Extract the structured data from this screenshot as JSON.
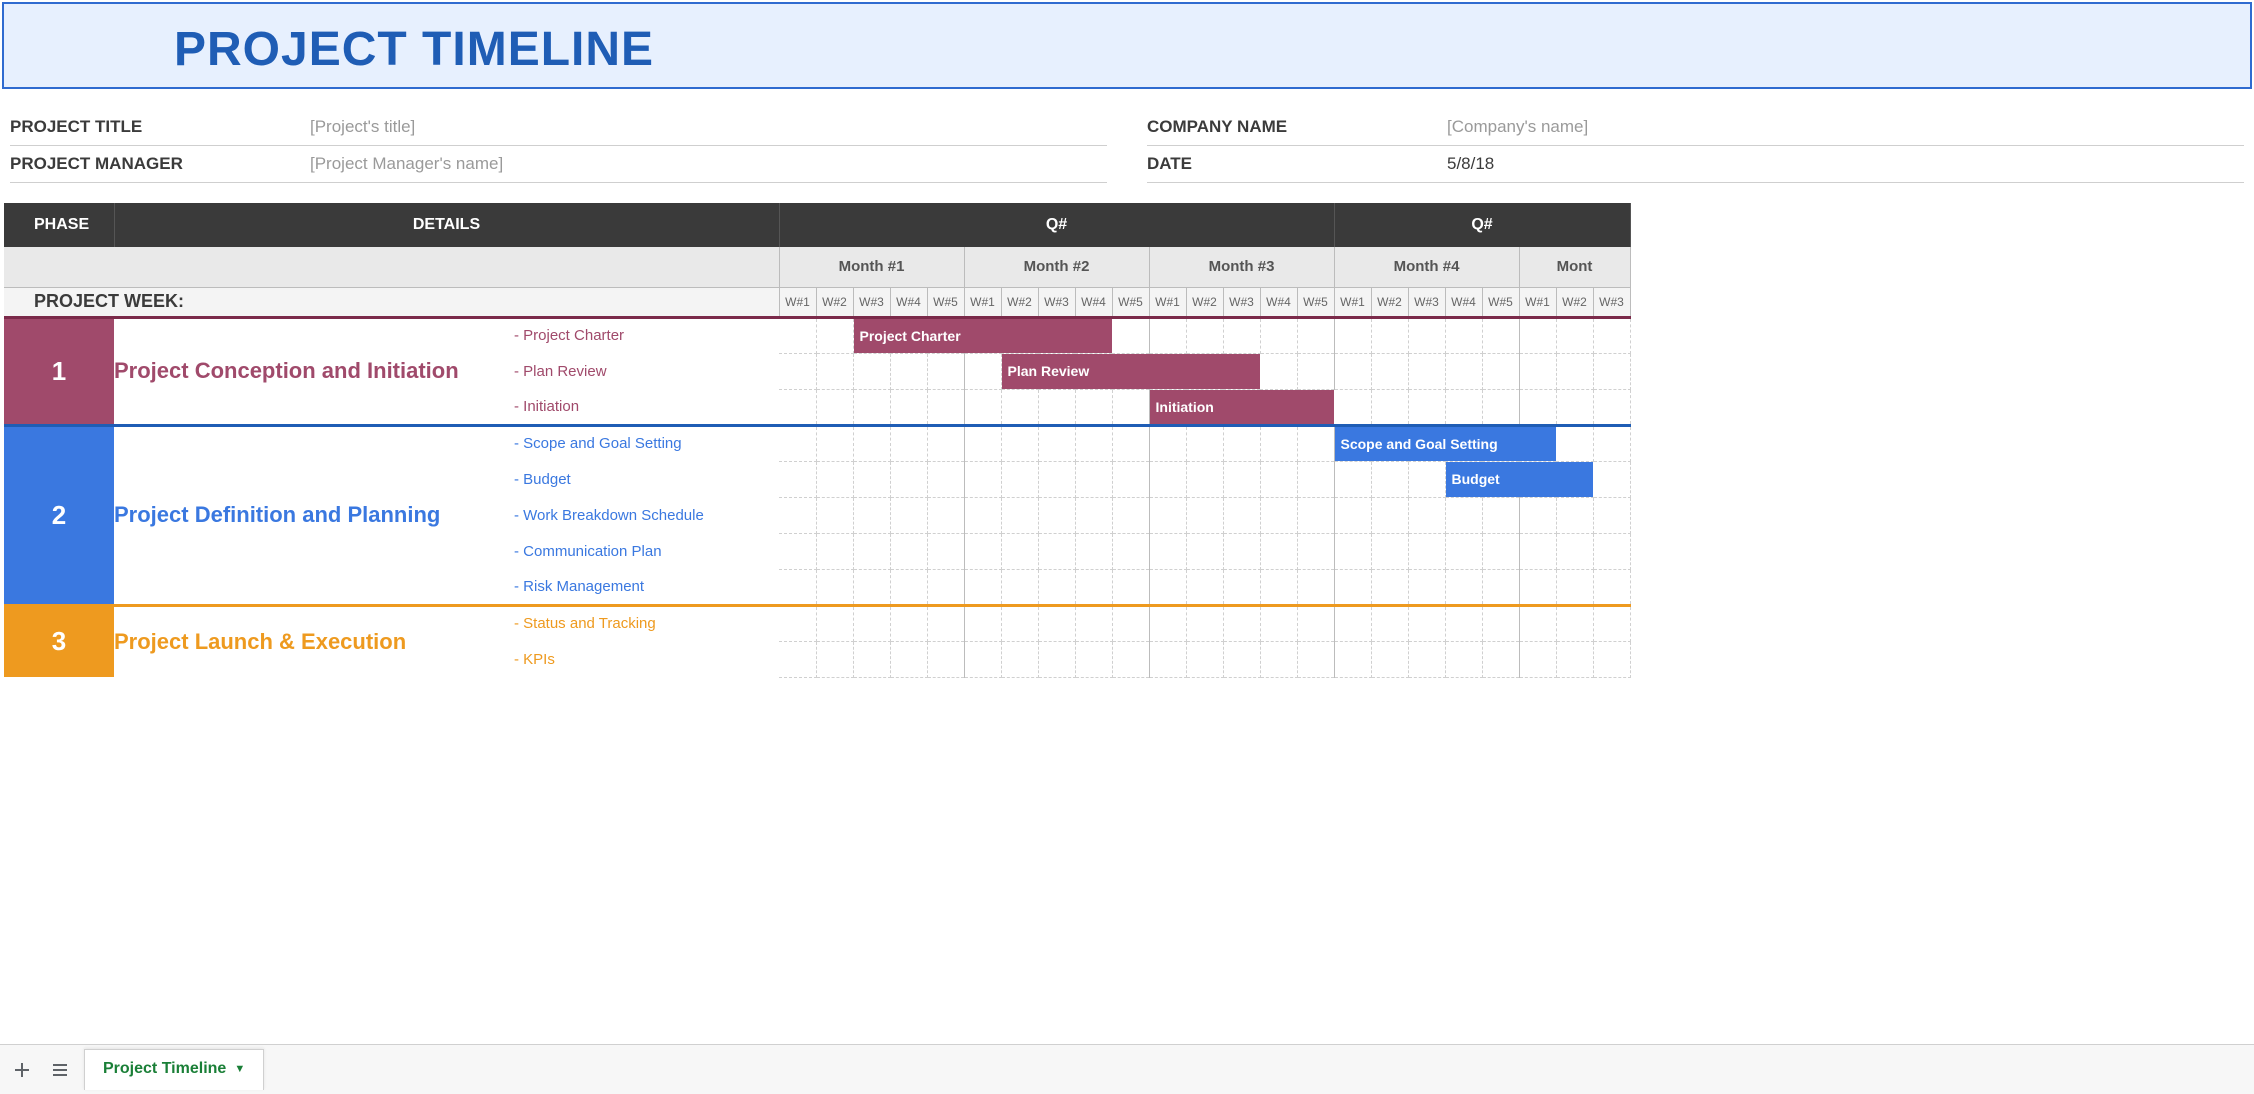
{
  "banner_title": "PROJECT TIMELINE",
  "meta": {
    "left": [
      {
        "label": "PROJECT TITLE",
        "value": "[Project's title]",
        "solid": false
      },
      {
        "label": "PROJECT MANAGER",
        "value": "[Project Manager's name]",
        "solid": false
      }
    ],
    "right": [
      {
        "label": "COMPANY NAME",
        "value": "[Company's name]",
        "solid": false
      },
      {
        "label": "DATE",
        "value": "5/8/18",
        "solid": true
      }
    ]
  },
  "headers": {
    "phase": "PHASE",
    "details": "DETAILS",
    "project_week": "PROJECT WEEK:",
    "quarter": "Q#",
    "months": [
      "Month #1",
      "Month #2",
      "Month #3",
      "Month #4",
      "Mont"
    ],
    "weeks": [
      "W#1",
      "W#2",
      "W#3",
      "W#4",
      "W#5"
    ]
  },
  "phases": [
    {
      "num": "1",
      "class": "ph1",
      "txtClass": "ph1-txt",
      "sep": "s1",
      "name": "Project Conception and Initiation",
      "rows": [
        {
          "detail": "- Project Charter",
          "bar": {
            "start": 2,
            "span": 7,
            "label": "Project Charter",
            "cls": "ph1b"
          }
        },
        {
          "detail": "- Plan Review",
          "bar": {
            "start": 6,
            "span": 7,
            "label": "Plan Review",
            "cls": "ph1b"
          }
        },
        {
          "detail": "- Initiation",
          "bar": {
            "start": 10,
            "span": 5,
            "label": "Initiation",
            "cls": "ph1b"
          }
        }
      ]
    },
    {
      "num": "2",
      "class": "ph2",
      "txtClass": "ph2-txt",
      "sep": "s2",
      "name": "Project Definition and Planning",
      "rows": [
        {
          "detail": "- Scope and Goal Setting",
          "bar": {
            "start": 15,
            "span": 6,
            "label": "Scope and Goal Setting",
            "cls": "ph2b"
          }
        },
        {
          "detail": "- Budget",
          "bar": {
            "start": 18,
            "span": 4,
            "label": "Budget",
            "cls": "ph2b"
          }
        },
        {
          "detail": "- Work Breakdown Schedule",
          "bar": null
        },
        {
          "detail": "- Communication Plan",
          "bar": null
        },
        {
          "detail": "- Risk Management",
          "bar": null
        }
      ]
    },
    {
      "num": "3",
      "class": "ph3",
      "txtClass": "ph3-txt",
      "sep": "s3",
      "name": "Project Launch & Execution",
      "rows": [
        {
          "detail": "- Status and Tracking",
          "bar": null
        },
        {
          "detail": "- KPIs",
          "bar": null
        }
      ]
    }
  ],
  "totalWeeks": 23,
  "sheet_tab": "Project Timeline"
}
